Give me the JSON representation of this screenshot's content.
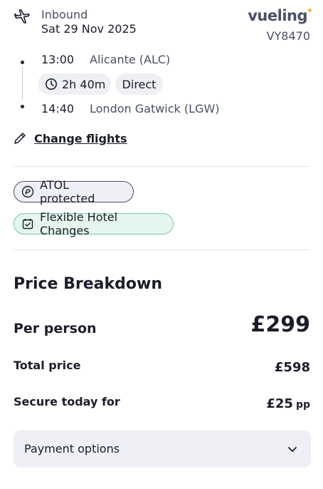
{
  "flight": {
    "direction": "Inbound",
    "date": "Sat 29 Nov 2025",
    "airline": "vueling",
    "flight_number": "VY8470",
    "departure_time": "13:00",
    "departure_place": "Alicante (ALC)",
    "duration": "2h 40m",
    "stops": "Direct",
    "arrival_time": "14:40",
    "arrival_place": "London Gatwick (LGW)",
    "change_label": "Change flights"
  },
  "badges": {
    "atol": "ATOL protected",
    "flexible": "Flexible Hotel Changes"
  },
  "price": {
    "title": "Price Breakdown",
    "per_person_label": "Per person",
    "per_person_value": "£299",
    "total_label": "Total price",
    "total_value": "£598",
    "secure_label": "Secure today for",
    "secure_value": "£25",
    "secure_unit": "pp"
  },
  "payment": {
    "label": "Payment options"
  },
  "colors": {
    "accent_dot": "#f2b43a",
    "flex_badge_bg": "#e5f6ee",
    "flex_badge_border": "#77c9a4"
  },
  "icons": [
    "plane-icon",
    "clock-icon",
    "pencil-icon",
    "atol-shield-icon",
    "calendar-check-icon",
    "chevron-down-icon"
  ]
}
